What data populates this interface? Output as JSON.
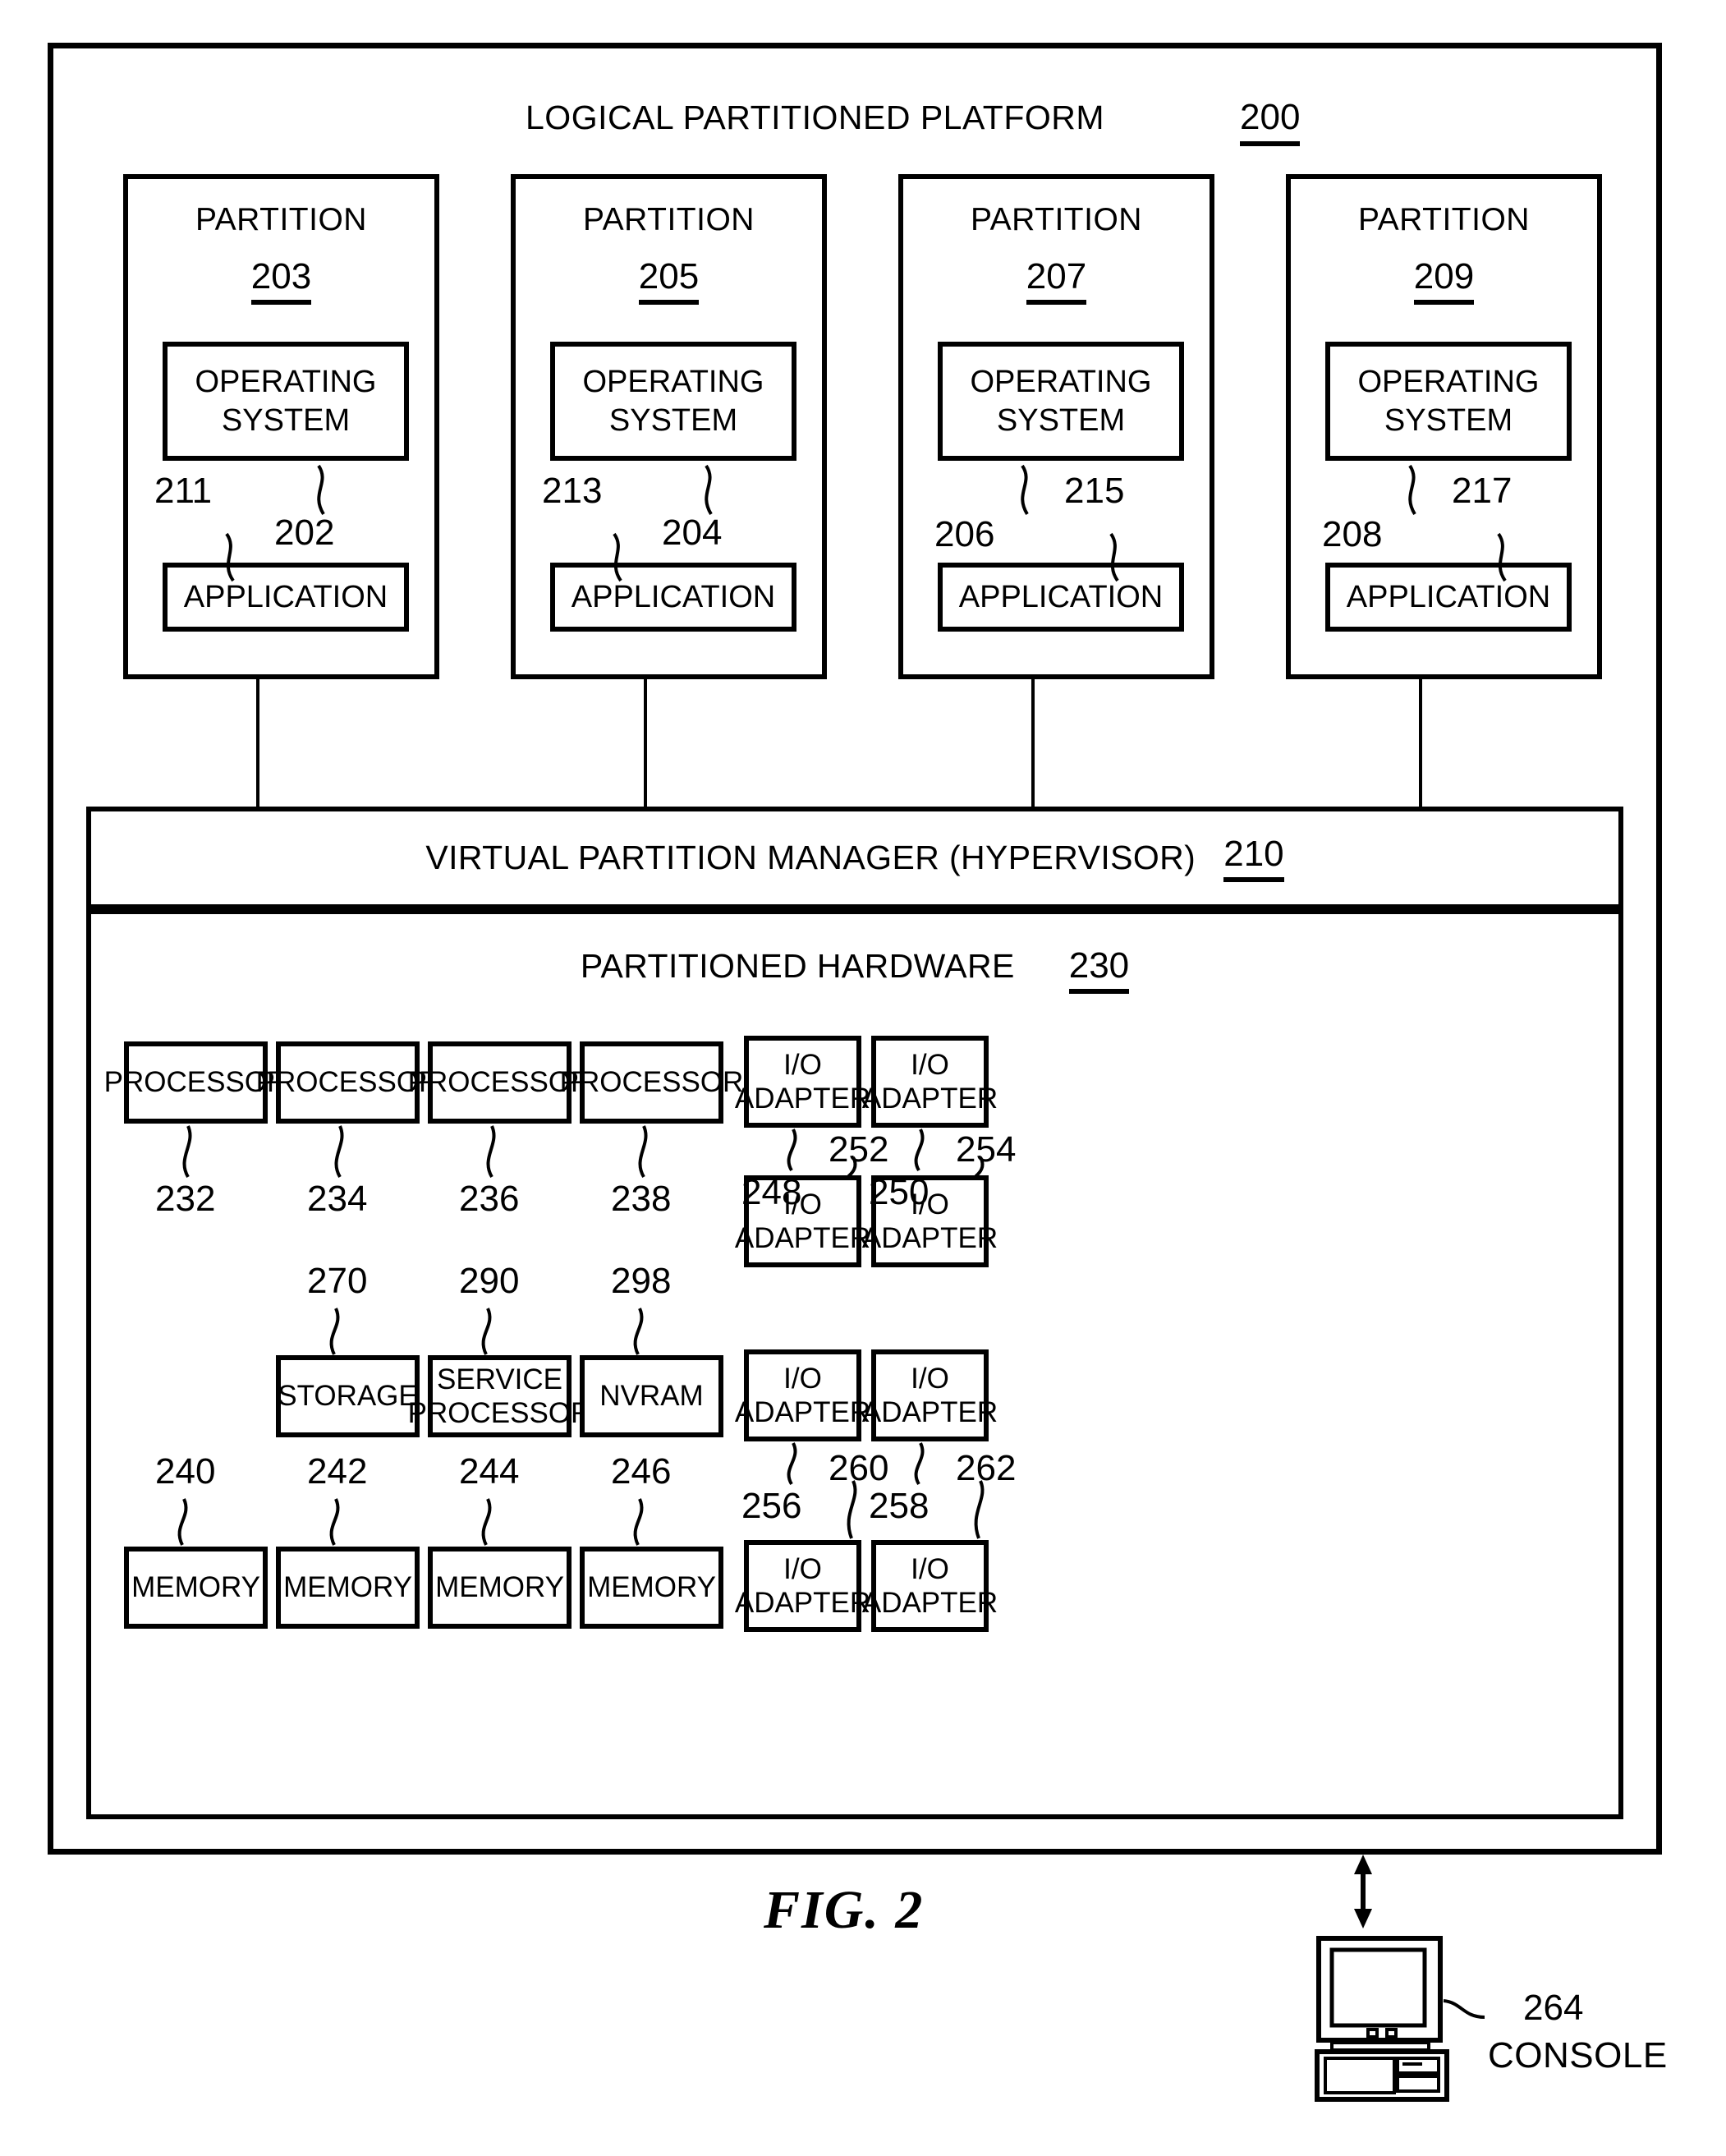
{
  "figure": {
    "caption": "FIG. 2",
    "platform_title": "LOGICAL PARTITIONED PLATFORM",
    "platform_ref": "200"
  },
  "partitions": [
    {
      "title": "PARTITION",
      "ref": "203",
      "os_label": "OPERATING\nSYSTEM",
      "os_line1": "OPERATING",
      "os_line2": "SYSTEM",
      "app_label": "APPLICATION",
      "left_ref": "211",
      "right_ref": "202",
      "left_points_to": "application",
      "right_points_to": "operating-system"
    },
    {
      "title": "PARTITION",
      "ref": "205",
      "os_line1": "OPERATING",
      "os_line2": "SYSTEM",
      "app_label": "APPLICATION",
      "left_ref": "213",
      "right_ref": "204",
      "left_points_to": "application",
      "right_points_to": "operating-system"
    },
    {
      "title": "PARTITION",
      "ref": "207",
      "os_line1": "OPERATING",
      "os_line2": "SYSTEM",
      "app_label": "APPLICATION",
      "left_ref": "206",
      "right_ref": "215",
      "left_points_to": "operating-system",
      "right_points_to": "application"
    },
    {
      "title": "PARTITION",
      "ref": "209",
      "os_line1": "OPERATING",
      "os_line2": "SYSTEM",
      "app_label": "APPLICATION",
      "left_ref": "208",
      "right_ref": "217",
      "left_points_to": "operating-system",
      "right_points_to": "application"
    }
  ],
  "hypervisor": {
    "title": "VIRTUAL PARTITION MANAGER (HYPERVISOR)",
    "ref": "210"
  },
  "hardware": {
    "title": "PARTITIONED HARDWARE",
    "ref": "230",
    "processors": [
      {
        "label": "PROCESSOR",
        "ref": "232"
      },
      {
        "label": "PROCESSOR",
        "ref": "234"
      },
      {
        "label": "PROCESSOR",
        "ref": "236"
      },
      {
        "label": "PROCESSOR",
        "ref": "238"
      }
    ],
    "middle": [
      {
        "label": "STORAGE",
        "ref": "270"
      },
      {
        "line1": "SERVICE",
        "line2": "PROCESSOR",
        "ref": "290"
      },
      {
        "label": "NVRAM",
        "ref": "298"
      }
    ],
    "memories": [
      {
        "label": "MEMORY",
        "ref": "240"
      },
      {
        "label": "MEMORY",
        "ref": "242"
      },
      {
        "label": "MEMORY",
        "ref": "244"
      },
      {
        "label": "MEMORY",
        "ref": "246"
      }
    ],
    "io_adapters": [
      {
        "line1": "I/O",
        "line2": "ADAPTER",
        "ref": "248"
      },
      {
        "line1": "I/O",
        "line2": "ADAPTER",
        "ref": "250"
      },
      {
        "line1": "I/O",
        "line2": "ADAPTER",
        "ref": "252"
      },
      {
        "line1": "I/O",
        "line2": "ADAPTER",
        "ref": "254"
      },
      {
        "line1": "I/O",
        "line2": "ADAPTER",
        "ref": "256"
      },
      {
        "line1": "I/O",
        "line2": "ADAPTER",
        "ref": "258"
      },
      {
        "line1": "I/O",
        "line2": "ADAPTER",
        "ref": "260"
      },
      {
        "line1": "I/O",
        "line2": "ADAPTER",
        "ref": "262"
      }
    ]
  },
  "console": {
    "ref": "264",
    "label": "CONSOLE"
  }
}
